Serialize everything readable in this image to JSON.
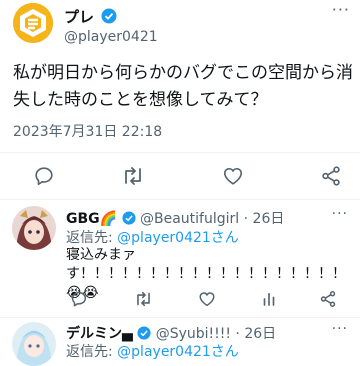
{
  "main_tweet": {
    "display_name": "プレ",
    "handle": "@player0421",
    "text": "私が明日から何らかのバグでこの空間から消失した時のことを想像してみて？",
    "timestamp": "2023年7月31日 22:18"
  },
  "replies": [
    {
      "display_name": "GBG🌈",
      "handle": "@Beautifulgirl",
      "date": "26日",
      "reply_to_prefix": "返信先: ",
      "reply_to_handle": "@player0421さん",
      "text": "寝込みまァす！！！！！！！！！！！！！！！！！！！😭😭"
    },
    {
      "display_name": "デルミン▄",
      "handle": "@Syubi!!!!",
      "date": "26日",
      "reply_to_prefix": "返信先: ",
      "reply_to_handle": "@player0421さん"
    }
  ],
  "colors": {
    "accent": "#1d9bf0",
    "verified_badge": "#1d9bf0",
    "secondary_text": "#536471",
    "icon_gray": "#536471"
  },
  "icons": {
    "main_actions": [
      "reply-icon",
      "retweet-icon",
      "like-icon",
      "share-icon"
    ],
    "reply_actions": [
      "reply-icon",
      "retweet-icon",
      "like-icon",
      "analytics-icon",
      "share-icon"
    ]
  }
}
